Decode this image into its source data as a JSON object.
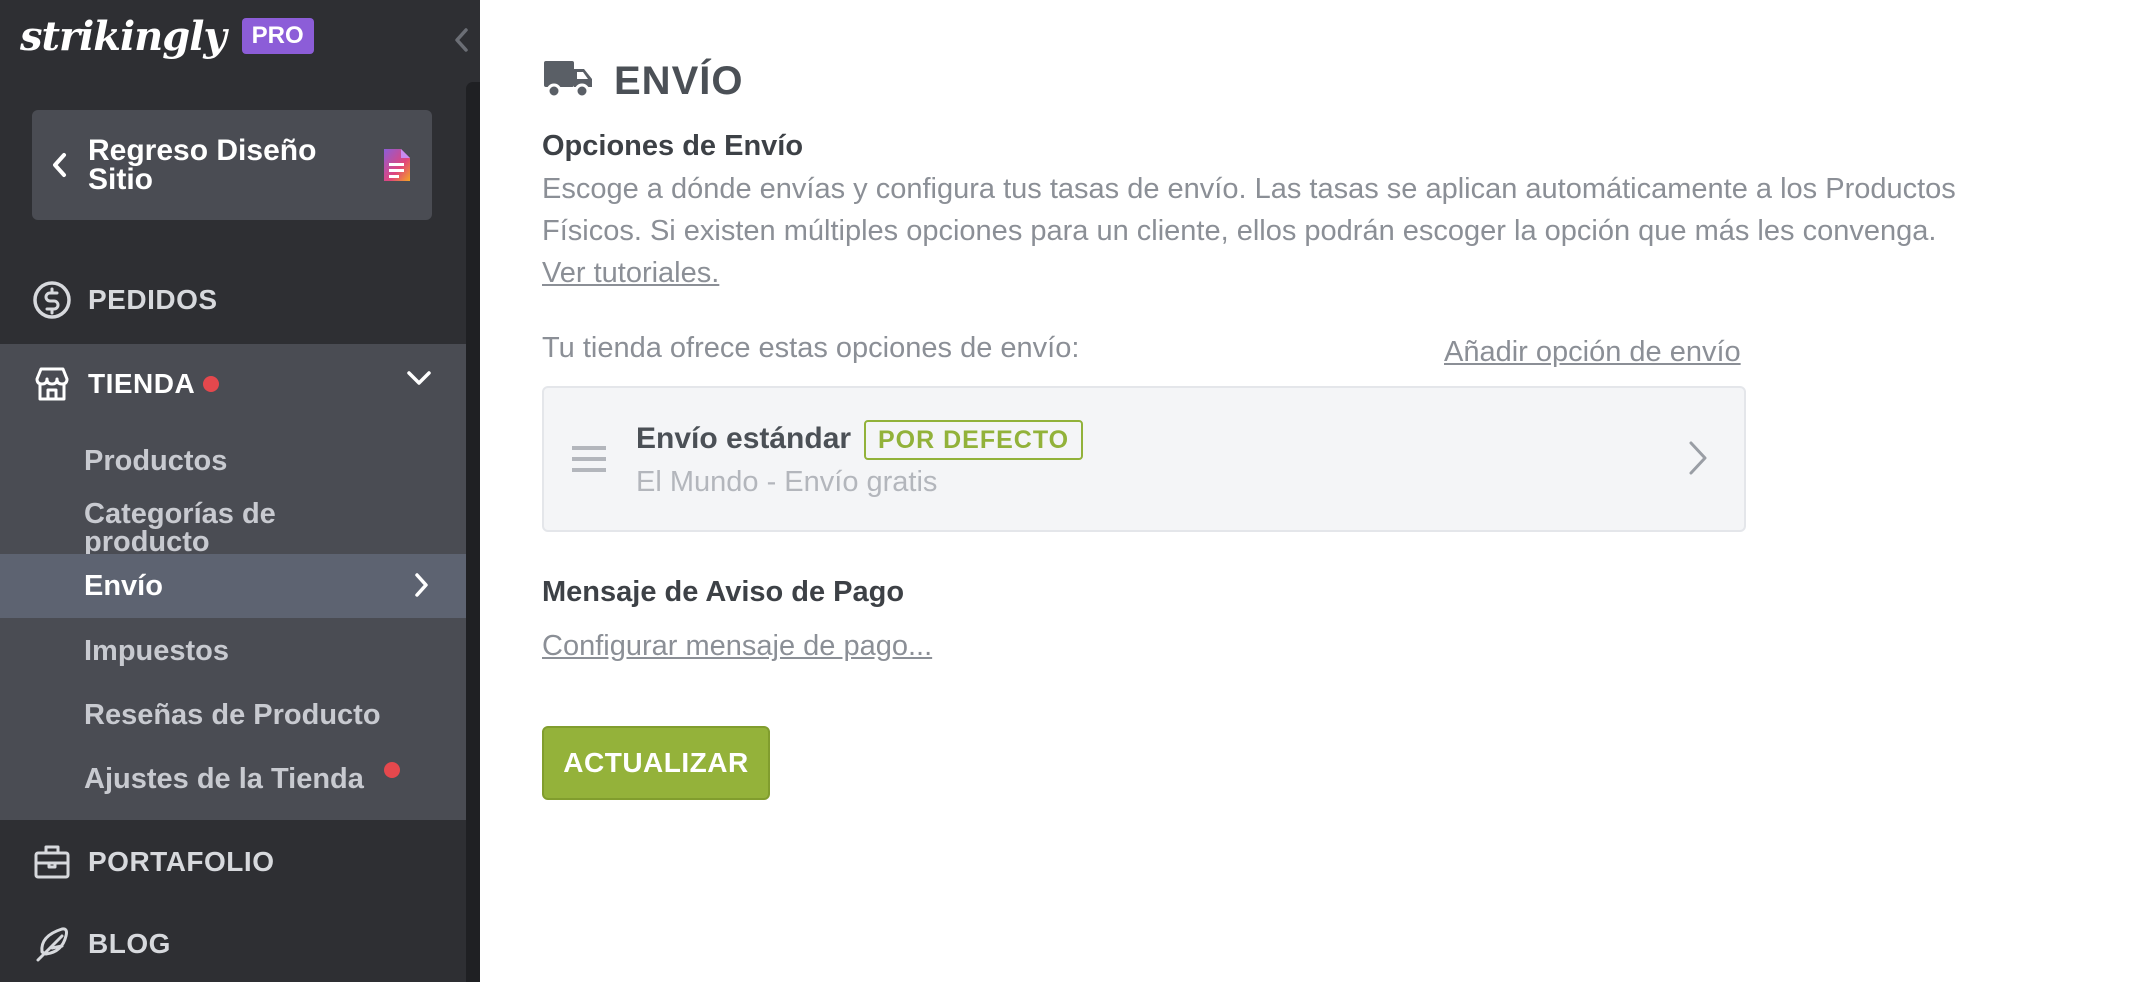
{
  "sidebar": {
    "brand": "strikingly",
    "plan_badge": "PRO",
    "back_label": "Regreso Diseño Sitio",
    "nav": {
      "pedidos": "PEDIDOS",
      "tienda": "TIENDA",
      "portafolio": "PORTAFOLIO",
      "blog": "BLOG"
    },
    "store_items": [
      {
        "label": "Productos"
      },
      {
        "label": "Categorías de producto"
      },
      {
        "label": "Envío"
      },
      {
        "label": "Impuestos"
      },
      {
        "label": "Reseñas de Producto"
      },
      {
        "label": "Ajustes de la Tienda"
      }
    ],
    "active_item": "Envío",
    "notification_color": "#e5484d"
  },
  "main": {
    "title": "ENVÍO",
    "title_icon": "truck-icon",
    "options_heading": "Opciones de Envío",
    "options_description": "Escoge a dónde envías y configura tus tasas de envío. Las tasas se aplican automáticamente a los Productos Físicos. Si existen múltiples opciones para un cliente, ellos podrán escoger la opción que más les convenga.",
    "tutorials_link": "Ver tutoriales.",
    "store_offers": "Tu tienda ofrece estas opciones de envío:",
    "add_option_link": "Añadir opción de envío",
    "shipping_options": [
      {
        "name": "Envío estándar",
        "badge": "POR DEFECTO",
        "detail": "El Mundo - Envío gratis"
      }
    ],
    "payment_notice_heading": "Mensaje de Aviso de Pago",
    "configure_payment_link": "Configurar mensaje de pago...",
    "update_button": "ACTUALIZAR",
    "accent_color": "#94b23a"
  }
}
